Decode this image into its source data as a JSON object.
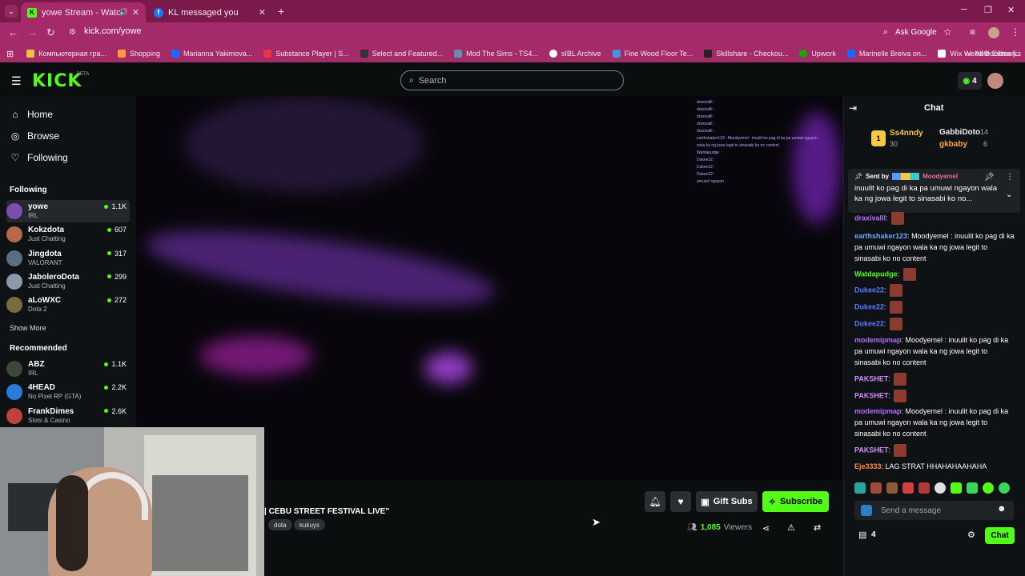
{
  "browser": {
    "tabs": [
      {
        "title": "yowe Stream - Watch Live o",
        "active": true
      },
      {
        "title": "KL messaged you",
        "active": false
      }
    ],
    "url": "kick.com/yowe",
    "ask_google": "Ask Google",
    "bookmarks": [
      "Компьютерная гра...",
      "Shopping",
      "Marianna Yakimova...",
      "Substance Player | S...",
      "Select and Featured...",
      "Mod The Sims - TS4...",
      "sIBL Archive",
      "Fine Wood Floor Te...",
      "Skillshare - Checkou...",
      "Upwork",
      "Marinelle Breiva on...",
      "Wix Website Editor |..."
    ],
    "all_bookmarks": "All Bookmarks"
  },
  "header": {
    "logo": "KICK",
    "beta": "BETA",
    "search_placeholder": "Search",
    "badge_count": "4"
  },
  "sidebar": {
    "nav": [
      {
        "label": "Home",
        "icon": "home-icon"
      },
      {
        "label": "Browse",
        "icon": "compass-icon"
      },
      {
        "label": "Following",
        "icon": "heart-icon"
      }
    ],
    "following_title": "Following",
    "following": [
      {
        "name": "yowe",
        "category": "IRL",
        "viewers": "1.1K",
        "color": "#7a4fb0"
      },
      {
        "name": "Kokzdota",
        "category": "Just Chatting",
        "viewers": "607",
        "color": "#b5694a"
      },
      {
        "name": "Jingdota",
        "category": "VALORANT",
        "viewers": "317",
        "color": "#5a6e80"
      },
      {
        "name": "JaboleroDota",
        "category": "Just Chatting",
        "viewers": "299",
        "color": "#8a9aa8"
      },
      {
        "name": "aLoWXC",
        "category": "Dota 2",
        "viewers": "272",
        "color": "#7a6a40"
      }
    ],
    "show_more": "Show More",
    "recommended_title": "Recommended",
    "recommended": [
      {
        "name": "ABZ",
        "category": "IRL",
        "viewers": "1.1K",
        "color": "#3a4a3a"
      },
      {
        "name": "4HEAD",
        "category": "No Pixel RP (GTA)",
        "viewers": "2.2K",
        "color": "#2a7ad8"
      },
      {
        "name": "FrankDimes",
        "category": "Slots & Casino",
        "viewers": "2.6K",
        "color": "#c04040"
      }
    ]
  },
  "stream": {
    "title": "| CEBU STREET FESTIVAL LIVE\"",
    "tags": [
      "dota",
      "kukuys"
    ],
    "gift_subs": "Gift Subs",
    "subscribe": "Subscribe",
    "viewers_count": "1,085",
    "viewers_label": "Viewers",
    "overlay_lines": [
      "draxivalll :",
      "draxivalll :",
      "draxivalll :",
      "draxivalll :",
      "draxivalll :",
      "earthshaker123 : Moodyemel : inuulit ko pag di ka pa umuwi ngayon",
      "wala ka ng jowa legit to sinasabi ko no content",
      "Watdapudge :",
      "Dukee22 :",
      "Dukee22 :",
      "Dukee22 :",
      "amusel ngayon"
    ]
  },
  "chat": {
    "title": "Chat",
    "leaderboard": [
      {
        "name": "Ss4nndy",
        "value": "30",
        "rank": "1"
      },
      {
        "name": "GabbiDoto",
        "value": "14"
      },
      {
        "name": "gkbaby",
        "value": "6"
      }
    ],
    "pinned": {
      "sent_by": "Sent by",
      "user": "Moodyemel",
      "text": "inuulit ko pag di ka pa umuwi ngayon wala ka ng jowa legit to sinasabi ko no..."
    },
    "messages": [
      {
        "user": "draxivalll",
        "text": "",
        "color": "#b46bff"
      },
      {
        "user": "earthshaker123",
        "text": "Moodyemel : inuulit ko pag di ka pa umuwi ngayon wala ka ng jowa legit to sinasabi ko no content",
        "color": "#6ba5ff"
      },
      {
        "user": "Watdapudge",
        "text": "",
        "color": "#53fc18"
      },
      {
        "user": "Dukee22",
        "text": "",
        "color": "#5a7bff"
      },
      {
        "user": "Dukee22",
        "text": "",
        "color": "#5a7bff"
      },
      {
        "user": "Dukee22",
        "text": "",
        "color": "#5a7bff"
      },
      {
        "user": "modemipmap",
        "text": "Moodyemel : inuulit ko pag di ka pa umuwi ngayon wala ka ng jowa legit to sinasabi ko no content",
        "color": "#b46bff"
      },
      {
        "user": "PAKSHET",
        "text": "",
        "color": "#d08bff"
      },
      {
        "user": "PAKSHET",
        "text": "",
        "color": "#d08bff"
      },
      {
        "user": "modemipmap",
        "text": "Moodyemel : inuulit ko pag di ka pa umuwi ngayon wala ka ng jowa legit to sinasabi ko no content",
        "color": "#b46bff"
      },
      {
        "user": "PAKSHET",
        "text": "",
        "color": "#d08bff"
      },
      {
        "user": "Eje3333",
        "text": "LAG STRAT HHAHAHAAHAHA",
        "color": "#ff8a3a"
      }
    ],
    "input_placeholder": "Send a message",
    "points": "4",
    "send": "Chat",
    "accent": "#53fc18"
  }
}
